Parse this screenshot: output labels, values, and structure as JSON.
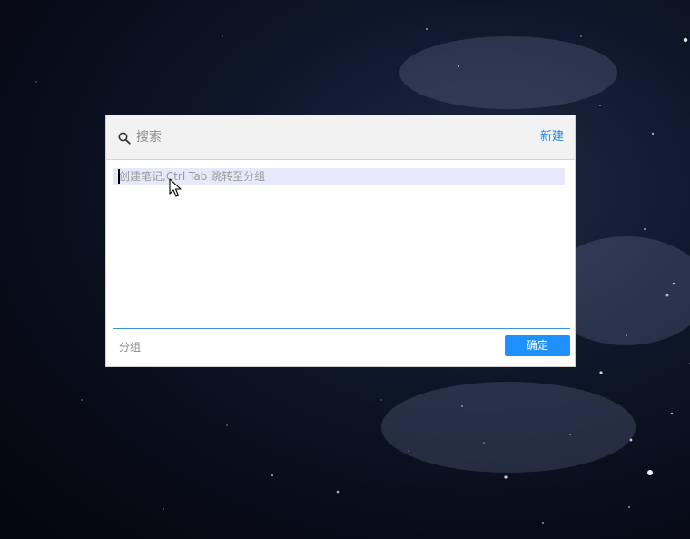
{
  "search": {
    "placeholder": "搜索",
    "icon": "search-icon"
  },
  "header": {
    "new_label": "新建"
  },
  "note": {
    "placeholder": "创建笔记,Ctrl Tab 跳转至分组"
  },
  "footer": {
    "group_label": "分组",
    "confirm_label": "确定"
  },
  "colors": {
    "accent": "#1e90ff",
    "link": "#1e88e5",
    "input_highlight": "#e7e8fa"
  }
}
